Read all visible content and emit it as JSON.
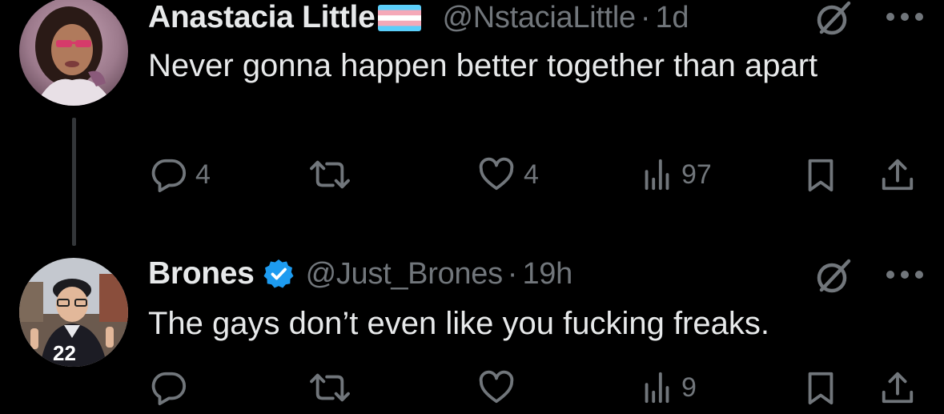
{
  "tweets": [
    {
      "display_name": "Anastacia Little",
      "handle": "@NstaciaLittle",
      "separator": "·",
      "time": "1d",
      "flag": "transgender-flag",
      "text": "Never gonna happen better together than apart",
      "reply_count": "4",
      "retweet_count": "",
      "like_count": "4",
      "view_count": "97"
    },
    {
      "display_name": "Brones",
      "handle": "@Just_Brones",
      "separator": "·",
      "time": "19h",
      "badge": "verified-badge",
      "text": "The gays don’t even like you fucking freaks.",
      "reply_count": "",
      "retweet_count": "",
      "like_count": "",
      "view_count": "9"
    }
  ],
  "colors": {
    "background": "#000000",
    "primary_text": "#e7e9ea",
    "secondary_text": "#71767b",
    "verified_blue": "#1d9bf0",
    "thread_line": "#333639",
    "flag_blue": "#5bcefa",
    "flag_pink": "#f5a9b8",
    "flag_white": "#ffffff"
  }
}
